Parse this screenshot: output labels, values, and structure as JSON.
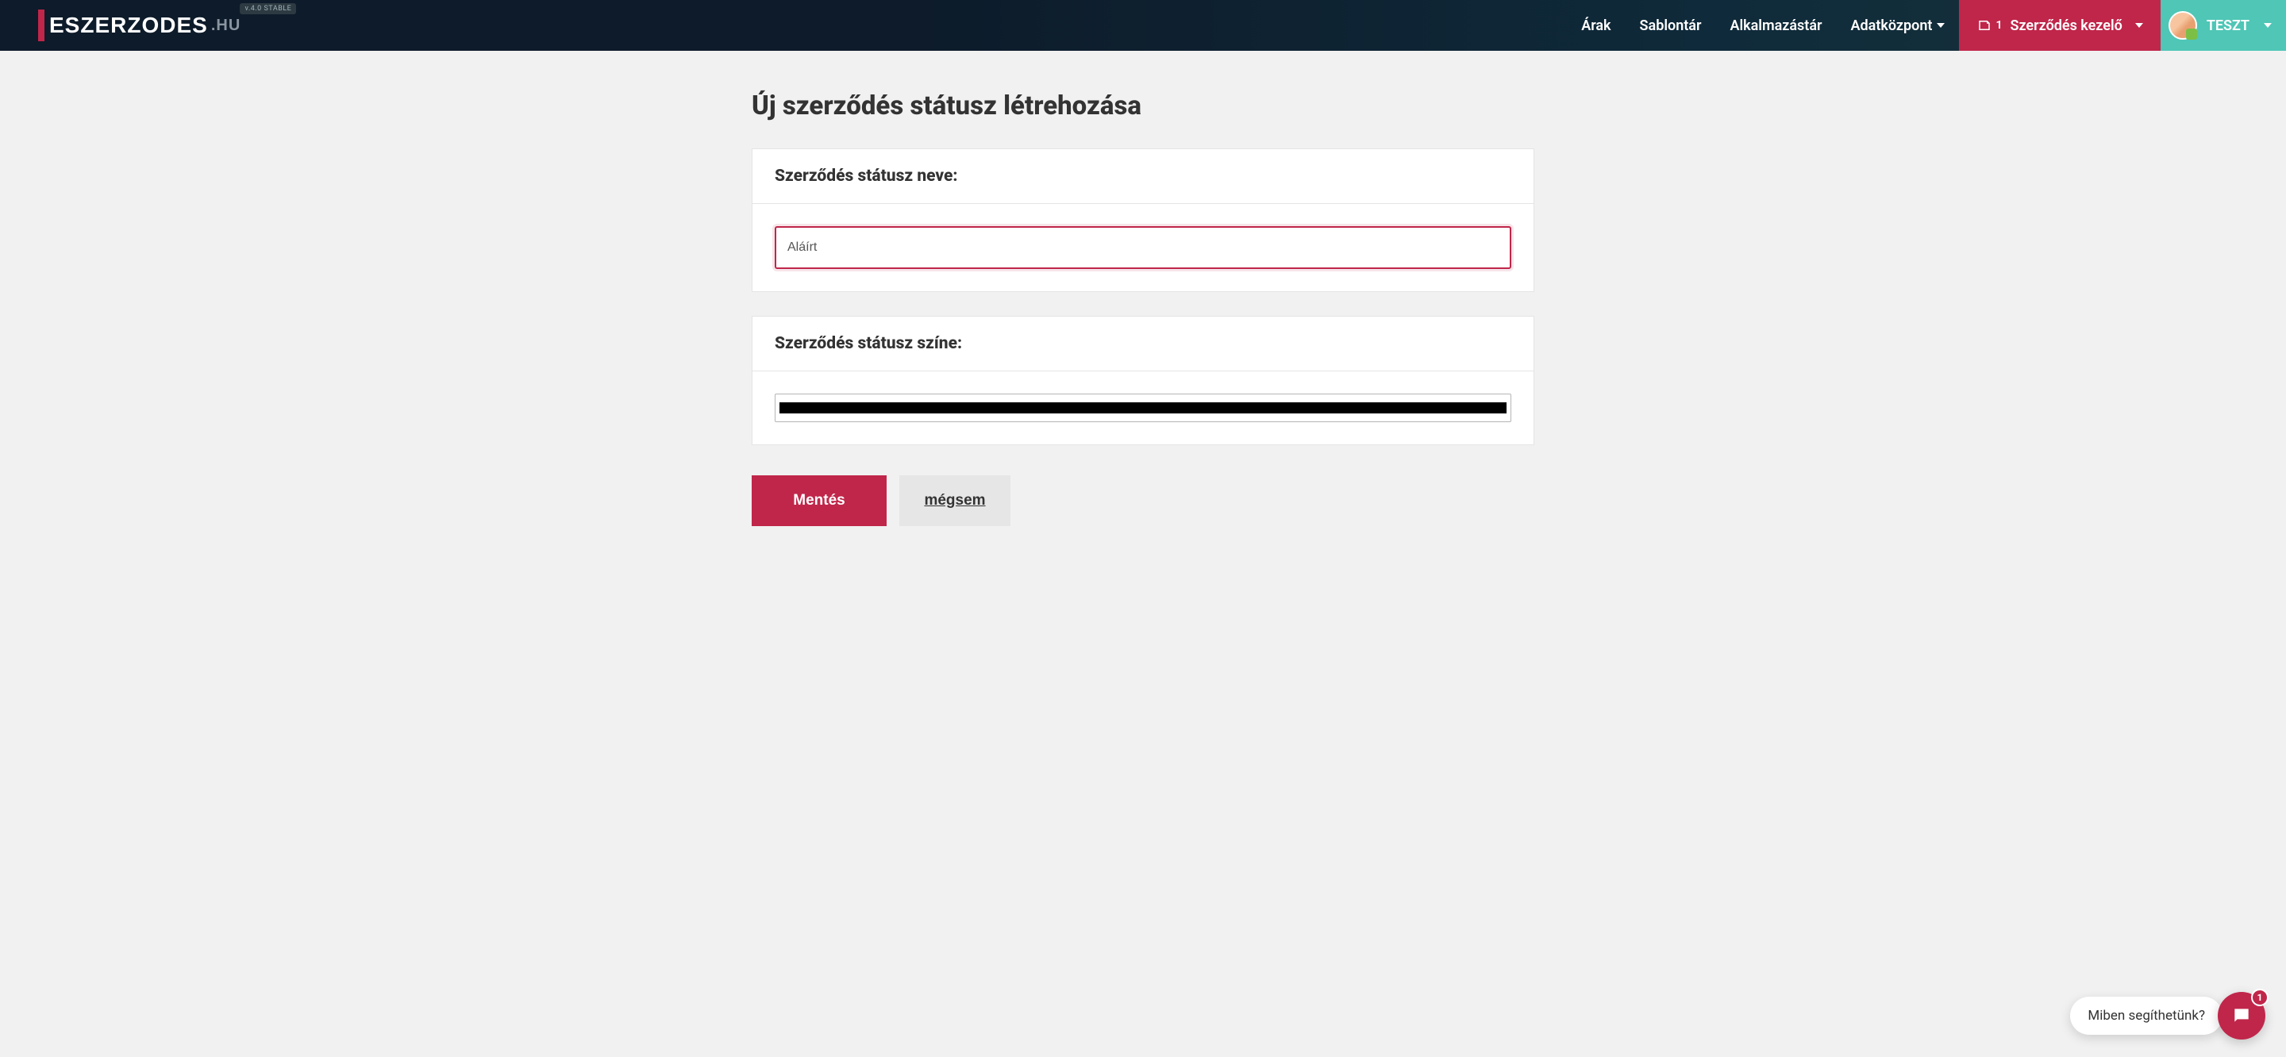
{
  "header": {
    "logo_main": "ESZERZODES",
    "logo_suffix": ".HU",
    "version": "v.4.0 STABLE",
    "nav": {
      "prices": "Árak",
      "templates": "Sablontár",
      "apps": "Alkalmazástár",
      "datacenter": "Adatközpont",
      "contract_manager_badge": "1",
      "contract_manager": "Szerződés kezelő",
      "user": "TESZT"
    }
  },
  "page": {
    "title": "Új szerződés státusz létrehozása",
    "panel_name_label": "Szerződés státusz neve:",
    "status_name_value": "Aláírt",
    "panel_color_label": "Szerződés státusz színe:",
    "color_value": "#000000",
    "save": "Mentés",
    "cancel": "mégsem"
  },
  "chat": {
    "prompt": "Miben segíthetünk?",
    "badge": "1"
  }
}
